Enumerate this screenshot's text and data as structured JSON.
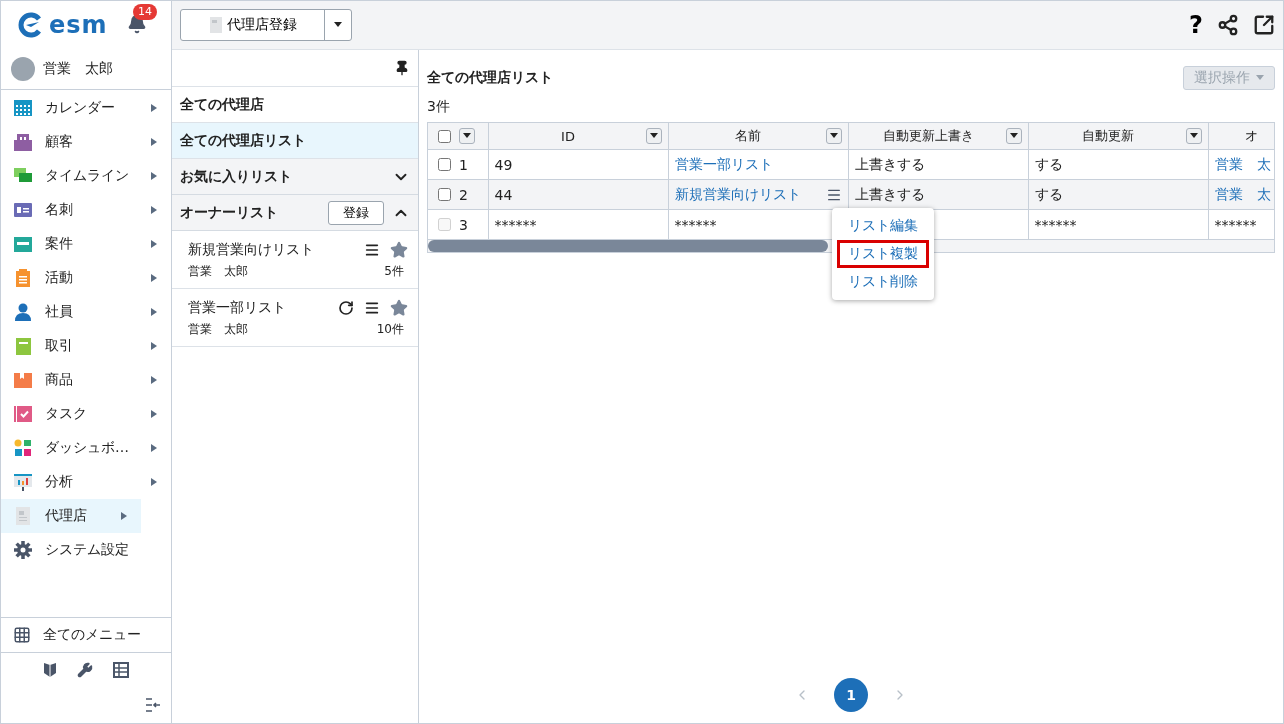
{
  "sidebar": {
    "logo": "esm",
    "notifications": "14",
    "user": "営業　太郎",
    "items": [
      {
        "label": "カレンダー",
        "kind": "calendar",
        "submenu": true,
        "selected": false
      },
      {
        "label": "顧客",
        "kind": "building",
        "submenu": true,
        "selected": false
      },
      {
        "label": "タイムライン",
        "kind": "chat",
        "submenu": true,
        "selected": false
      },
      {
        "label": "名刺",
        "kind": "card",
        "submenu": true,
        "selected": false
      },
      {
        "label": "案件",
        "kind": "folder",
        "submenu": true,
        "selected": false
      },
      {
        "label": "活動",
        "kind": "clipboard",
        "submenu": true,
        "selected": false
      },
      {
        "label": "社員",
        "kind": "person",
        "submenu": true,
        "selected": false
      },
      {
        "label": "取引",
        "kind": "book",
        "submenu": true,
        "selected": false
      },
      {
        "label": "商品",
        "kind": "box",
        "submenu": true,
        "selected": false
      },
      {
        "label": "タスク",
        "kind": "check",
        "submenu": true,
        "selected": false
      },
      {
        "label": "ダッシュボ…",
        "kind": "dashboard",
        "submenu": true,
        "selected": false
      },
      {
        "label": "分析",
        "kind": "chart",
        "submenu": true,
        "selected": false
      },
      {
        "label": "代理店",
        "kind": "document",
        "submenu": true,
        "selected": true
      },
      {
        "label": "システム設定",
        "kind": "gear",
        "submenu": false,
        "selected": false
      }
    ],
    "all_menu": "全てのメニュー"
  },
  "toolbar": {
    "register_button": "代理店登録",
    "help": "?"
  },
  "list_panel": {
    "items": [
      {
        "label": "全ての代理店",
        "selected": false
      },
      {
        "label": "全ての代理店リスト",
        "selected": true
      }
    ],
    "sections": [
      {
        "label": "お気に入りリスト",
        "expanded": false
      },
      {
        "label": "オーナーリスト",
        "expanded": true,
        "button": "登録"
      }
    ],
    "owner_lists": [
      {
        "name": "新規営業向けリスト",
        "owner": "営業　太郎",
        "count": "5件",
        "auto_update": false
      },
      {
        "name": "営業一部リスト",
        "owner": "営業　太郎",
        "count": "10件",
        "auto_update": true
      }
    ]
  },
  "main": {
    "title": "全ての代理店リスト",
    "count": "3件",
    "action_button": {
      "label": "選択操作",
      "disabled": true
    },
    "table": {
      "select_all_checked": false,
      "columns": [
        {
          "label": "ID",
          "filter": true,
          "link": false
        },
        {
          "label": "名前",
          "filter": true,
          "link": true
        },
        {
          "label": "自動更新上書き",
          "filter": true,
          "link": false
        },
        {
          "label": "自動更新",
          "filter": true,
          "link": false
        },
        {
          "label": "オ",
          "filter": false,
          "link": true
        }
      ],
      "rows": [
        {
          "number": "1",
          "masked": false,
          "checked": false,
          "disabled": false,
          "hovered": false,
          "cells": [
            "49",
            "営業一部リスト",
            "上書きする",
            "する",
            "営業　太"
          ]
        },
        {
          "number": "2",
          "masked": false,
          "checked": false,
          "disabled": false,
          "hovered": true,
          "cells": [
            "44",
            "新規営業向けリスト",
            "上書きする",
            "する",
            "営業　太"
          ]
        },
        {
          "number": "3",
          "masked": true,
          "checked": false,
          "disabled": true,
          "hovered": false,
          "cells": [
            "******",
            "******",
            "",
            "******",
            "******"
          ]
        }
      ]
    },
    "context_menu": [
      {
        "label": "リスト編集",
        "selected": false
      },
      {
        "label": "リスト複製",
        "selected": true
      },
      {
        "label": "リスト削除",
        "selected": false
      }
    ],
    "pagination": [
      {
        "label": "1",
        "selected": true
      }
    ]
  }
}
